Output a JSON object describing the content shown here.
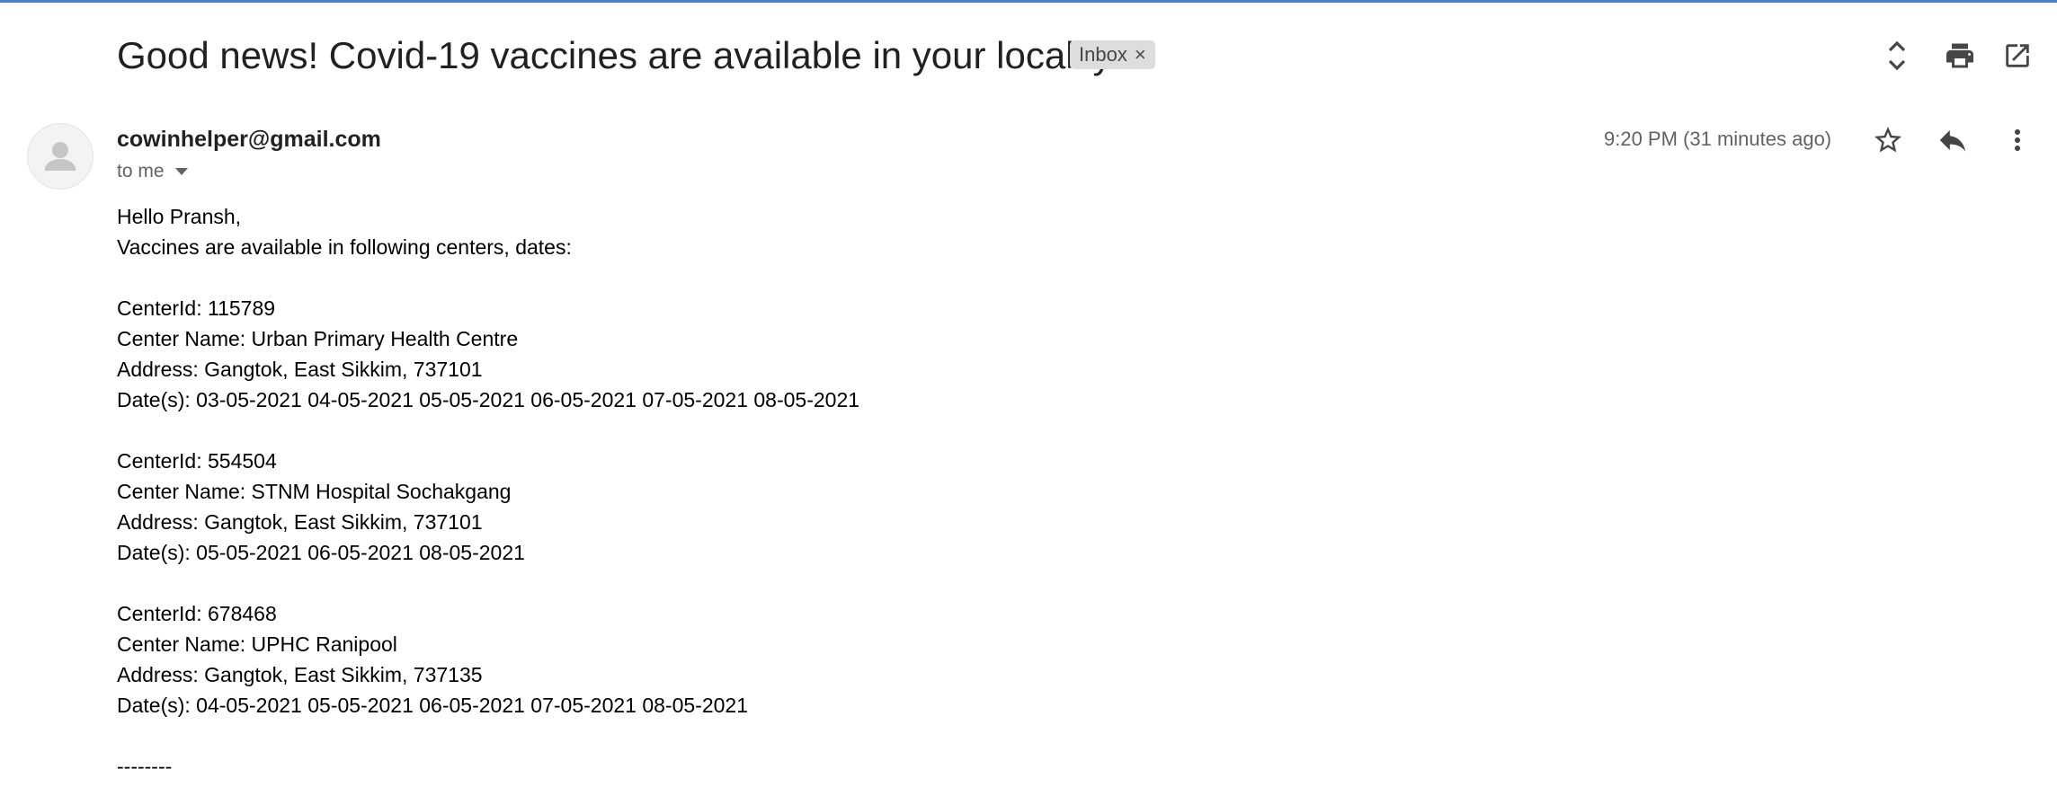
{
  "email": {
    "subject": "Good news! Covid-19 vaccines are available in your locality",
    "label": "Inbox",
    "label_remove": "×",
    "sender": "cowinhelper@gmail.com",
    "recipient_text": "to me",
    "timestamp": "9:20 PM (31 minutes ago)",
    "greeting": "Hello Pransh,",
    "intro": "Vaccines are available in following centers, dates:",
    "centers": [
      {
        "id_line": "CenterId: 115789",
        "name_line": "Center Name: Urban Primary Health Centre",
        "address_line": "Address: Gangtok, East Sikkim, 737101",
        "dates_line": "Date(s): 03-05-2021 04-05-2021 05-05-2021 06-05-2021 07-05-2021 08-05-2021"
      },
      {
        "id_line": "CenterId: 554504",
        "name_line": "Center Name: STNM Hospital Sochakgang",
        "address_line": "Address: Gangtok, East Sikkim, 737101",
        "dates_line": "Date(s): 05-05-2021 06-05-2021 08-05-2021"
      },
      {
        "id_line": "CenterId: 678468",
        "name_line": "Center Name: UPHC Ranipool",
        "address_line": "Address: Gangtok, East Sikkim, 737135",
        "dates_line": "Date(s): 04-05-2021 05-05-2021 06-05-2021 07-05-2021 08-05-2021"
      }
    ],
    "separator": "--------"
  },
  "icons": {
    "expand": "unfold-icon",
    "print": "print-icon",
    "open_new_window": "open-in-new-icon",
    "star": "star-icon",
    "reply": "reply-icon",
    "more": "more-vert-icon",
    "avatar": "person-icon"
  },
  "colors": {
    "top_border": "#4a7ecf",
    "icon": "#444746",
    "label_chip_bg": "#dddddd",
    "muted_text": "#5f6368"
  }
}
